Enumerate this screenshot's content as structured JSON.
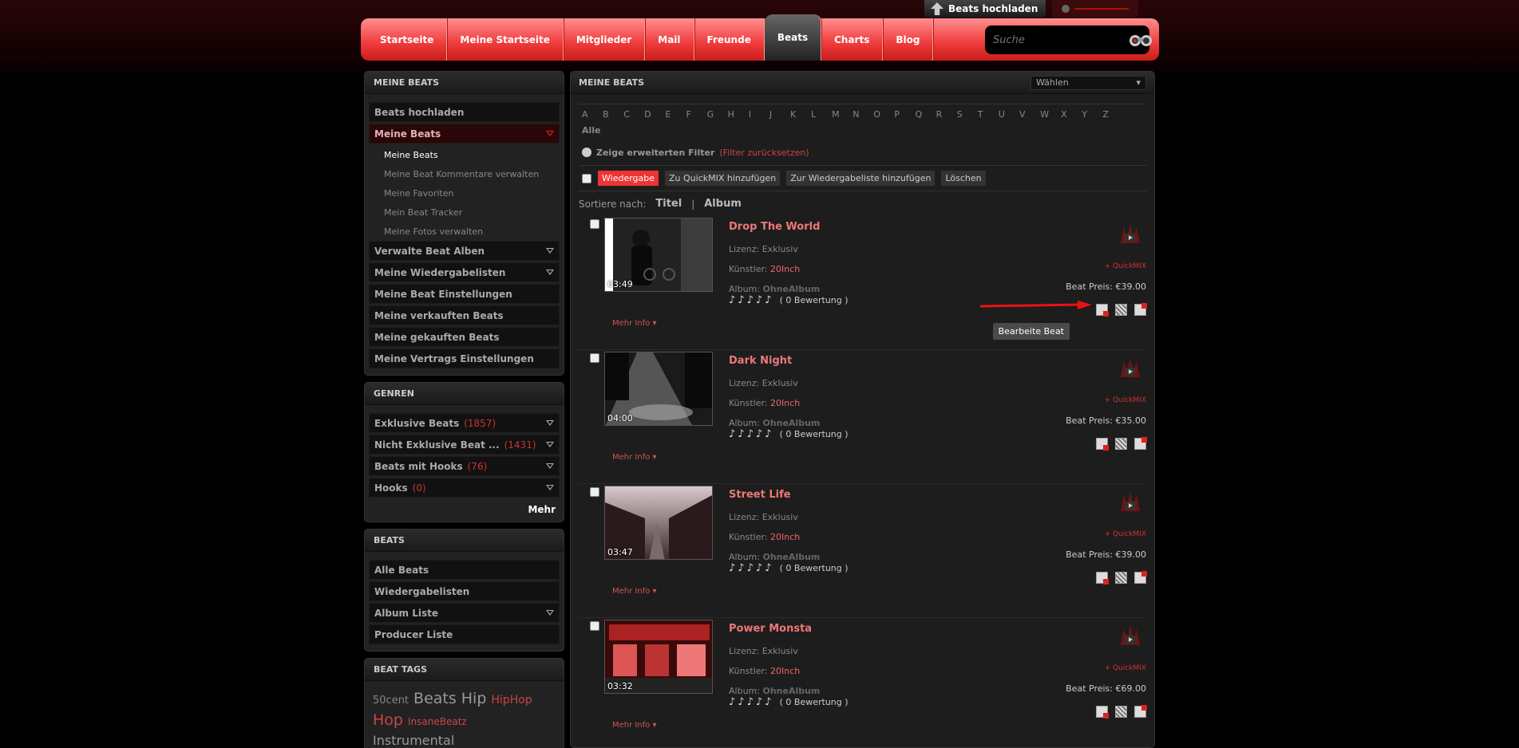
{
  "topbar": {
    "upload_label": "Beats hochladen"
  },
  "nav": {
    "items": [
      "Startseite",
      "Meine Startseite",
      "Mitglieder",
      "Mail",
      "Freunde",
      "Beats",
      "Charts",
      "Blog"
    ],
    "active": "Beats"
  },
  "search": {
    "placeholder": "Suche"
  },
  "sidebar": {
    "meine_beats": {
      "title": "MEINE BEATS",
      "upload": "Beats hochladen",
      "meine": "Meine Beats",
      "sub": [
        "Meine Beats",
        "Meine Beat Kommentare verwalten",
        "Meine Favoriten",
        "Mein Beat Tracker",
        "Meine Fotos verwalten"
      ],
      "rest": [
        "Verwalte Beat Alben",
        "Meine Wiedergabelisten",
        "Meine Beat Einstellungen",
        "Meine verkauften Beats",
        "Meine gekauften Beats",
        "Meine Vertrags Einstellungen"
      ]
    },
    "genren": {
      "title": "GENREN",
      "items": [
        {
          "label": "Exklusive Beats",
          "count": "(1857)"
        },
        {
          "label": "Nicht Exklusive Beat ...",
          "count": "(1431)"
        },
        {
          "label": "Beats mit Hooks",
          "count": "(76)"
        },
        {
          "label": "Hooks",
          "count": "(0)"
        }
      ],
      "mehr": "Mehr"
    },
    "beats": {
      "title": "BEATS",
      "items": [
        "Alle Beats",
        "Wiedergabelisten",
        "Album Liste",
        "Producer Liste"
      ]
    },
    "tags": {
      "title": "BEAT TAGS",
      "items": [
        "50cent",
        "Beats",
        "Hip",
        "HipHop",
        "Hop",
        "InsaneBeatz",
        "Instrumental"
      ]
    }
  },
  "main": {
    "title": "MEINE BEATS",
    "select": "Wählen",
    "letters": [
      "A",
      "B",
      "C",
      "D",
      "E",
      "F",
      "G",
      "H",
      "I",
      "J",
      "K",
      "L",
      "M",
      "N",
      "O",
      "P",
      "Q",
      "R",
      "S",
      "T",
      "U",
      "V",
      "W",
      "X",
      "Y",
      "Z"
    ],
    "all": "Alle",
    "filter_label": "Zeige erweiterten Filter",
    "filter_reset": "(Filter zurücksetzen)",
    "actions": [
      "Wiedergabe",
      "Zu QuickMIX hinzufügen",
      "Zur Wiedergabeliste hinzufügen",
      "Löschen"
    ],
    "sort_label": "Sortiere nach:",
    "sort_title": "Titel",
    "sort_sep": "|",
    "sort_album": "Album",
    "labels": {
      "lizenz": "Lizenz:",
      "kuenstler": "Künstler:",
      "album": "Album:",
      "price": "Beat Preis:",
      "quickmix": "+ QuickMIX",
      "mehrinfo": "Mehr Info ▾",
      "tooltip": "Bearbeite Beat"
    },
    "beats": [
      {
        "title": "Drop The World",
        "dur": "03:49",
        "lizenz": "Exklusiv",
        "artist": "20Inch",
        "album": "OhneAlbum",
        "rating": "( 0 Bewertung )",
        "price": "€39.00"
      },
      {
        "title": "Dark Night",
        "dur": "04:00",
        "lizenz": "Exklusiv",
        "artist": "20Inch",
        "album": "OhneAlbum",
        "rating": "( 0 Bewertung )",
        "price": "€35.00"
      },
      {
        "title": "Street Life",
        "dur": "03:47",
        "lizenz": "Exklusiv",
        "artist": "20Inch",
        "album": "OhneAlbum",
        "rating": "( 0 Bewertung )",
        "price": "€39.00"
      },
      {
        "title": "Power Monsta",
        "dur": "03:32",
        "lizenz": "Exklusiv",
        "artist": "20Inch",
        "album": "OhneAlbum",
        "rating": "( 0 Bewertung )",
        "price": "€69.00"
      }
    ]
  }
}
